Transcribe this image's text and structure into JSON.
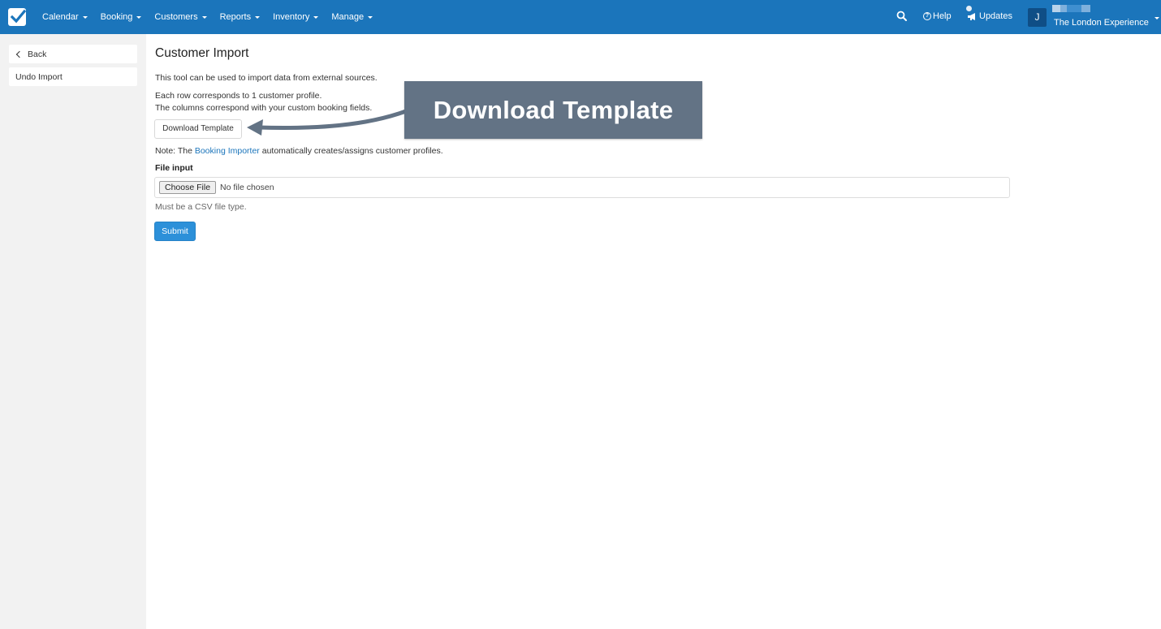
{
  "nav": {
    "items": [
      {
        "label": "Calendar"
      },
      {
        "label": "Booking"
      },
      {
        "label": "Customers"
      },
      {
        "label": "Reports"
      },
      {
        "label": "Inventory"
      },
      {
        "label": "Manage"
      }
    ],
    "help_label": "Help",
    "updates_label": "Updates",
    "avatar_initial": "J",
    "account_name": "The London Experience"
  },
  "sidebar": {
    "back_label": "Back",
    "undo_label": "Undo Import"
  },
  "main": {
    "title": "Customer Import",
    "intro": "This tool can be used to import data from external sources.",
    "row_info": "Each row corresponds to 1 customer profile.",
    "columns_info": "The columns correspond with your custom booking fields.",
    "download_button": "Download Template",
    "note_prefix": "Note: The ",
    "note_link": "Booking Importer",
    "note_suffix": " automatically creates/assigns customer profiles.",
    "file_label": "File input",
    "choose_file": "Choose File",
    "no_file": "No file chosen",
    "file_help": "Must be a CSV file type.",
    "submit": "Submit"
  },
  "callout": {
    "text": "Download Template"
  },
  "colors": {
    "topbar": "#1b75bb",
    "sidebar": "#f2f2f2",
    "primary_button": "#2c90d9",
    "callout": "#637385",
    "link": "#1b75bb"
  }
}
